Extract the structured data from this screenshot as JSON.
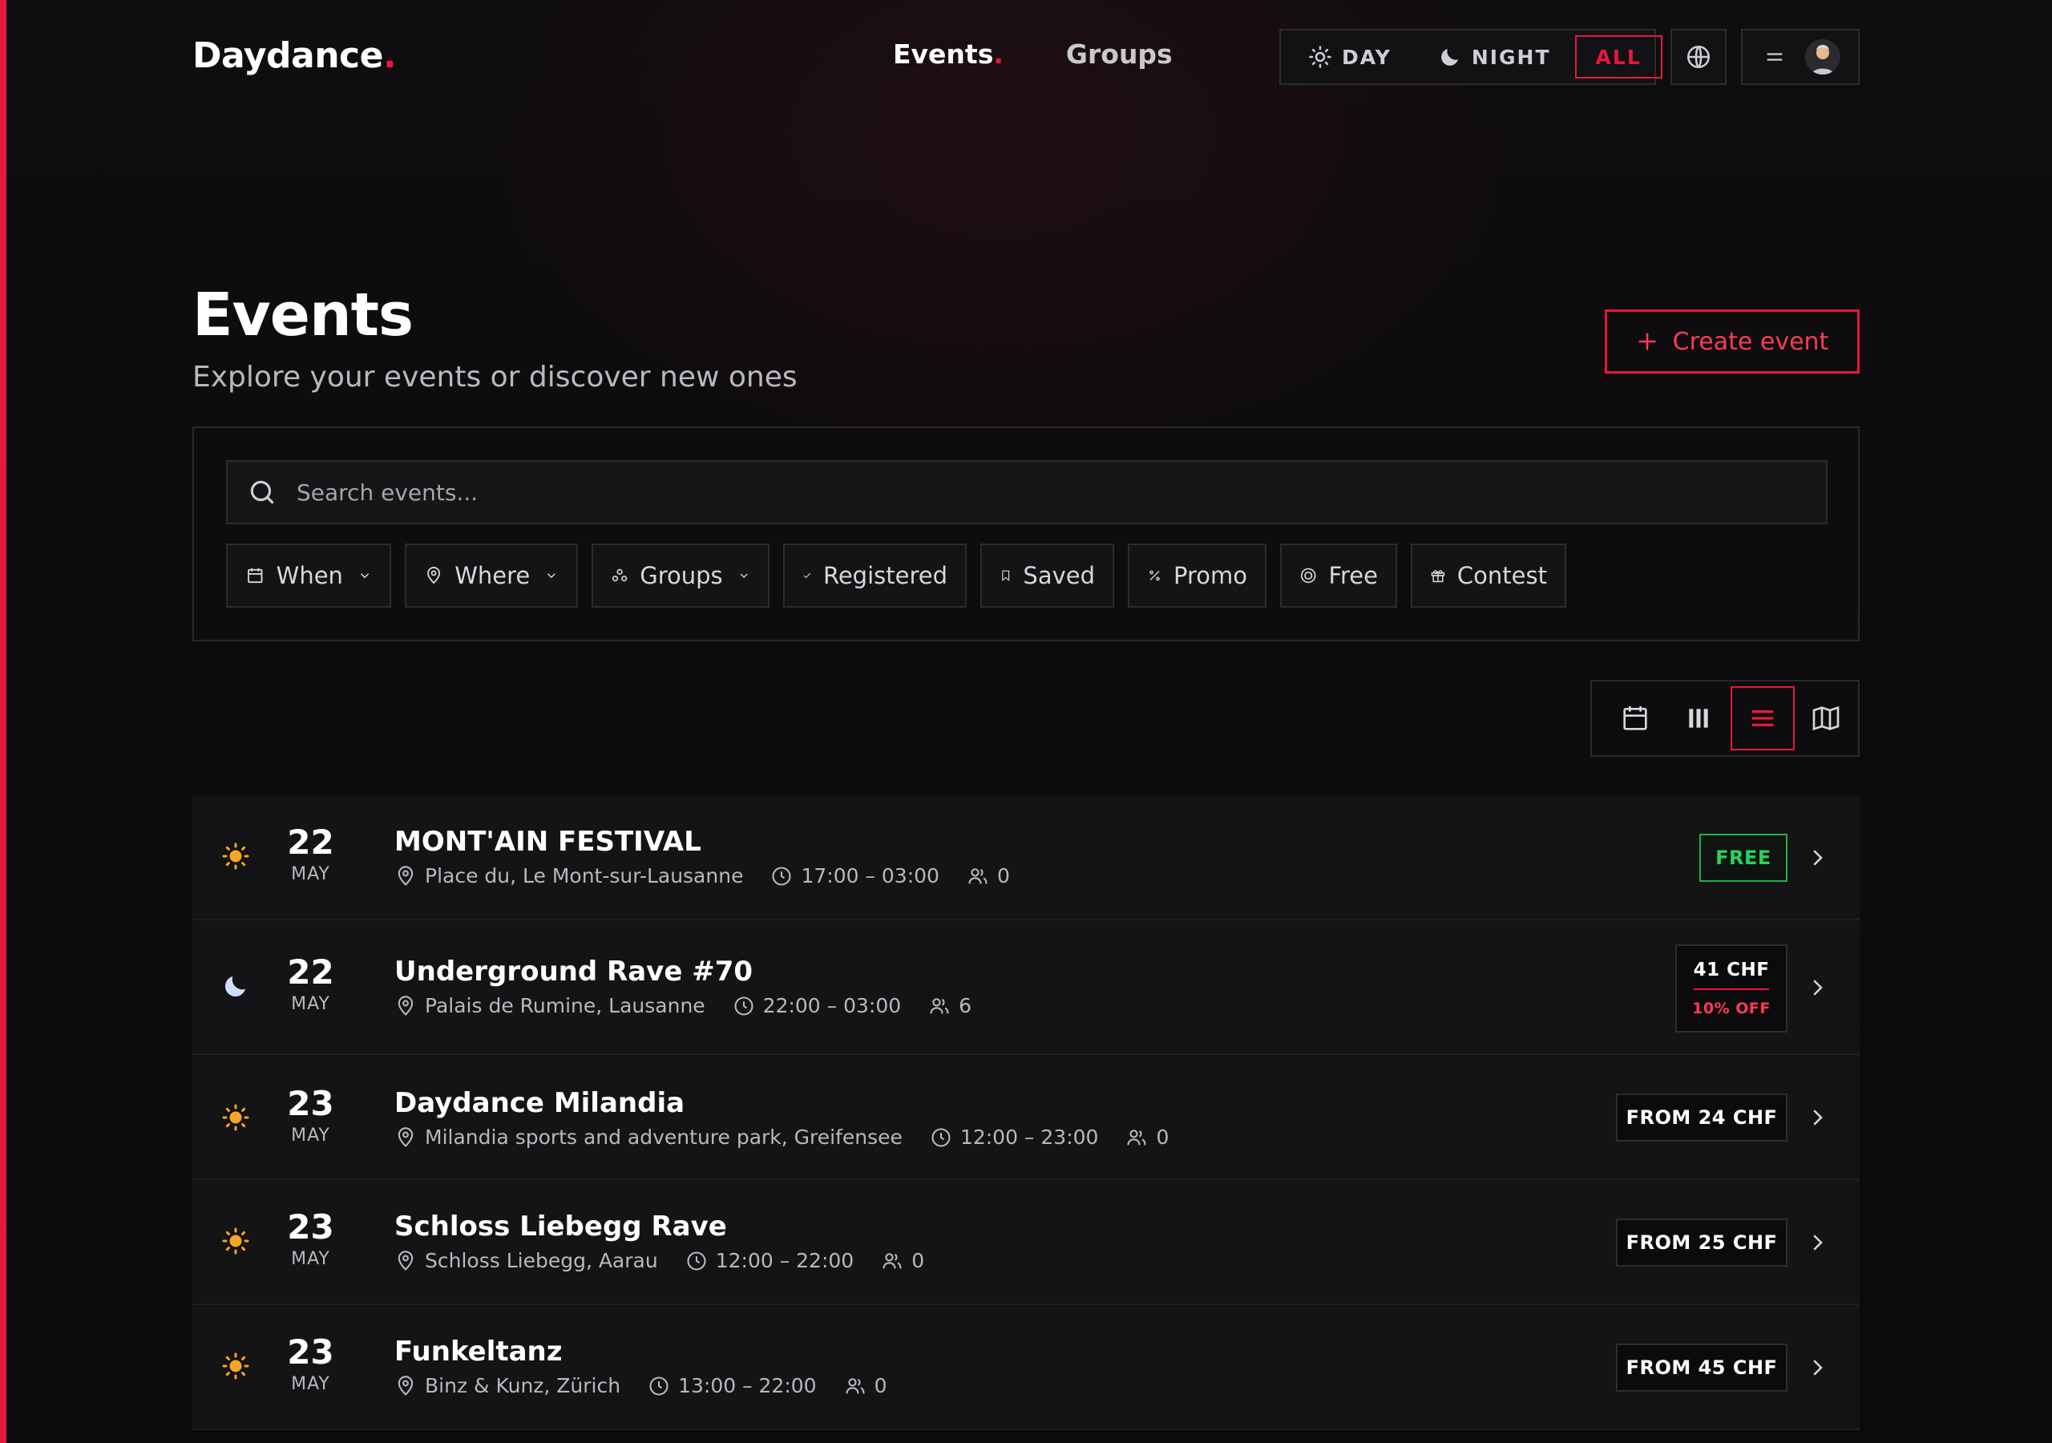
{
  "header": {
    "logo_text": "Daydance",
    "logo_dot": ".",
    "nav": [
      {
        "label": "Events",
        "active": true
      },
      {
        "label": "Groups",
        "active": false
      }
    ],
    "mode_toggle": {
      "day": "DAY",
      "night": "NIGHT",
      "all": "ALL",
      "selected": "ALL"
    }
  },
  "page": {
    "title": "Events",
    "subtitle": "Explore your events or discover new ones",
    "create_button": "Create event"
  },
  "filters": {
    "search_placeholder": "Search events...",
    "chips": [
      {
        "label": "When",
        "icon": "calendar-icon",
        "dropdown": true
      },
      {
        "label": "Where",
        "icon": "location-pin-icon",
        "dropdown": true
      },
      {
        "label": "Groups",
        "icon": "groups-icon",
        "dropdown": true
      },
      {
        "label": "Registered",
        "icon": "check-icon",
        "dropdown": false
      },
      {
        "label": "Saved",
        "icon": "bookmark-icon",
        "dropdown": false
      },
      {
        "label": "Promo",
        "icon": "percent-icon",
        "dropdown": false
      },
      {
        "label": "Free",
        "icon": "free-circle-icon",
        "dropdown": false
      },
      {
        "label": "Contest",
        "icon": "gift-icon",
        "dropdown": false
      }
    ]
  },
  "view_switch": {
    "options": [
      "calendar-view",
      "columns-view",
      "list-view",
      "map-view"
    ],
    "selected": "list-view"
  },
  "events": [
    {
      "icon": "sun-icon",
      "day": "22",
      "month": "MAY",
      "title": "MONT'AIN FESTIVAL",
      "location": "Place du, Le Mont-sur-Lausanne",
      "time": "17:00 – 03:00",
      "attendees": "0",
      "badge": "FREE"
    },
    {
      "icon": "moon-icon",
      "day": "22",
      "month": "MAY",
      "title": "Underground Rave #70",
      "location": "Palais de Rumine, Lausanne",
      "time": "22:00 – 03:00",
      "attendees": "6",
      "price": "41 CHF",
      "discount": "10% OFF"
    },
    {
      "icon": "sun-icon",
      "day": "23",
      "month": "MAY",
      "title": "Daydance Milandia",
      "location": "Milandia sports and adventure park, Greifensee",
      "time": "12:00 – 23:00",
      "attendees": "0",
      "price": "FROM 24 CHF"
    },
    {
      "icon": "sun-icon",
      "day": "23",
      "month": "MAY",
      "title": "Schloss Liebegg Rave",
      "location": "Schloss Liebegg, Aarau",
      "time": "12:00 – 22:00",
      "attendees": "0",
      "price": "FROM 25 CHF"
    },
    {
      "icon": "sun-icon",
      "day": "23",
      "month": "MAY",
      "title": "Funkeltanz",
      "location": "Binz & Kunz, Zürich",
      "time": "13:00 – 22:00",
      "attendees": "0",
      "price": "FROM 45 CHF"
    }
  ],
  "colors": {
    "accent": "#e4193d",
    "free_green": "#2bd25b",
    "sun_orange": "#f5a623",
    "moon_blue": "#cfe0ff",
    "background": "#0c0b0d"
  }
}
